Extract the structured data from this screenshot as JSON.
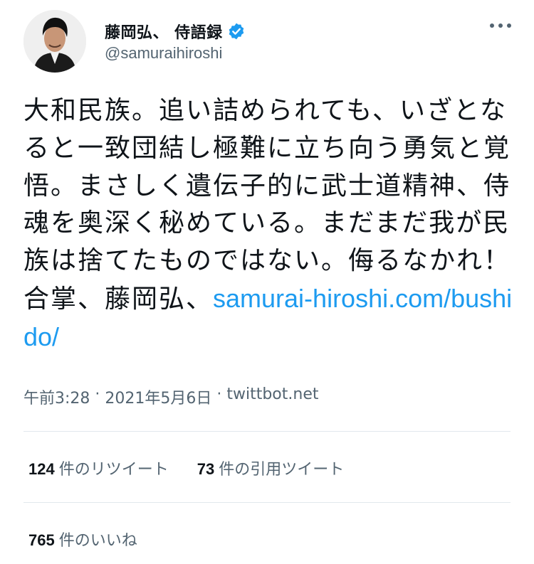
{
  "profile": {
    "display_name": "藤岡弘、 侍語録",
    "handle": "@samuraihiroshi",
    "verified": true
  },
  "tweet": {
    "text_main": "大和民族。追い詰められても、いざとなると一致団結し極難に立ち向う勇気と覚悟。まさしく遺伝子的に武士道精神、侍魂を奥深く秘めている。まだまだ我が民族は捨てたものではない。侮るなかれ！合掌、藤岡弘、",
    "link": "samurai-hiroshi.com/bushido/"
  },
  "meta": {
    "time": "午前3:28",
    "separator1": " · ",
    "date": "2021年5月6日",
    "separator2": " · ",
    "source": "twittbot.net"
  },
  "stats": {
    "retweets_count": "124",
    "retweets_label": "件のリツイート",
    "quotes_count": "73",
    "quotes_label": "件の引用ツイート",
    "likes_count": "765",
    "likes_label": "件のいいね"
  },
  "colors": {
    "link": "#1d9bf0",
    "verified": "#1d9bf0",
    "secondary_text": "#536471"
  },
  "icons": [
    "verified-badge-icon",
    "more-options-icon"
  ]
}
